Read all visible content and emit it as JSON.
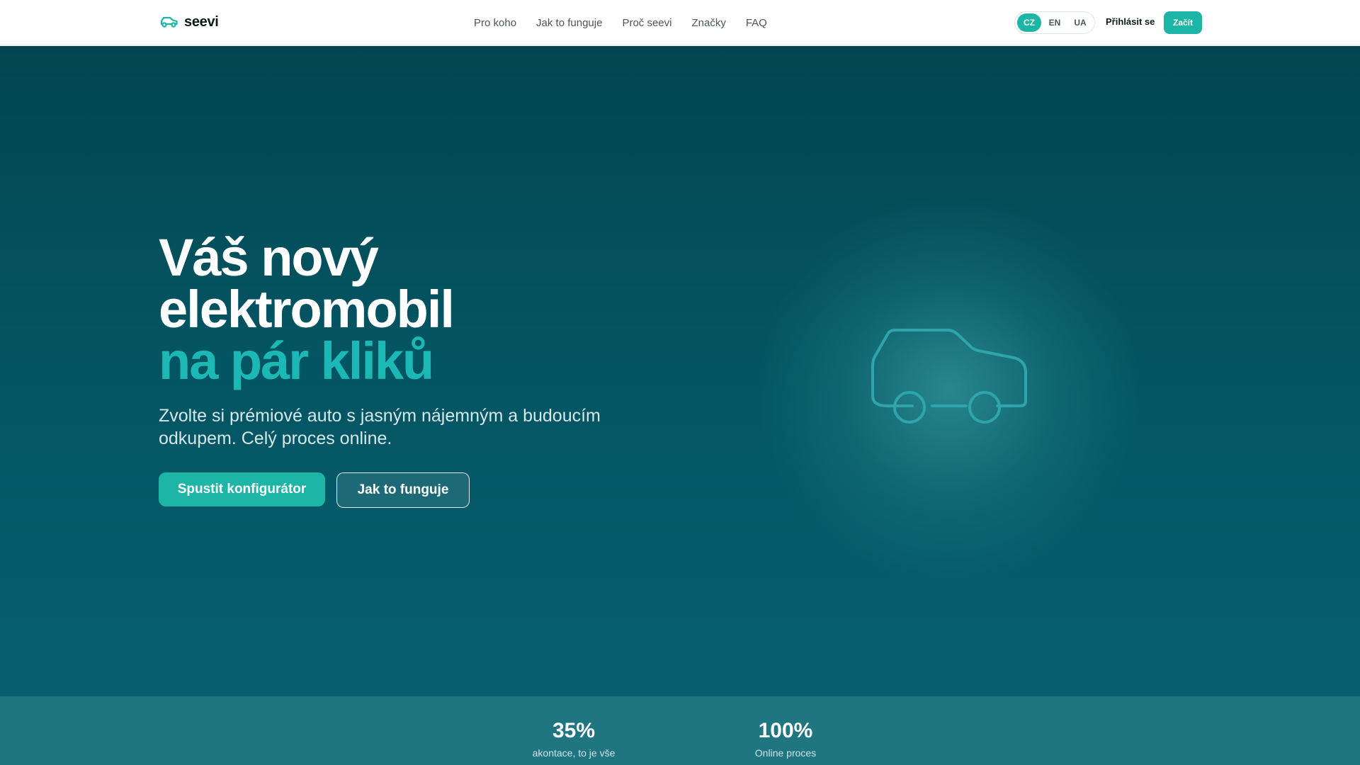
{
  "brand": {
    "name": "seevi",
    "logo_icon": "car-icon"
  },
  "nav": {
    "links": [
      "Pro koho",
      "Jak to funguje",
      "Proč seevi",
      "Značky",
      "FAQ"
    ],
    "languages": [
      "CZ",
      "EN",
      "UA"
    ],
    "active_language": "CZ",
    "login_label": "Přihlásit se",
    "start_label": "Začít"
  },
  "hero": {
    "title_line1": "Váš nový",
    "title_line2": "elektromobil",
    "title_accent": "na pár kliků",
    "subtitle": "Zvolte si prémiové auto s jasným nájemným a budoucím odkupem. Celý proces online.",
    "primary_cta": "Spustit konfigurátor",
    "secondary_cta": "Jak to funguje",
    "illustration_icon": "car-outline-icon"
  },
  "stats": [
    {
      "value": "35%",
      "label": "akontace, to je vše"
    },
    {
      "value": "100%",
      "label": "Online proces"
    }
  ],
  "colors": {
    "accent": "#1db5a6",
    "title_accent": "#1cb8b5",
    "hero_bg_top": "#02454f",
    "hero_bg_bottom": "#075f6e",
    "stats_bg": "#1f7681"
  }
}
